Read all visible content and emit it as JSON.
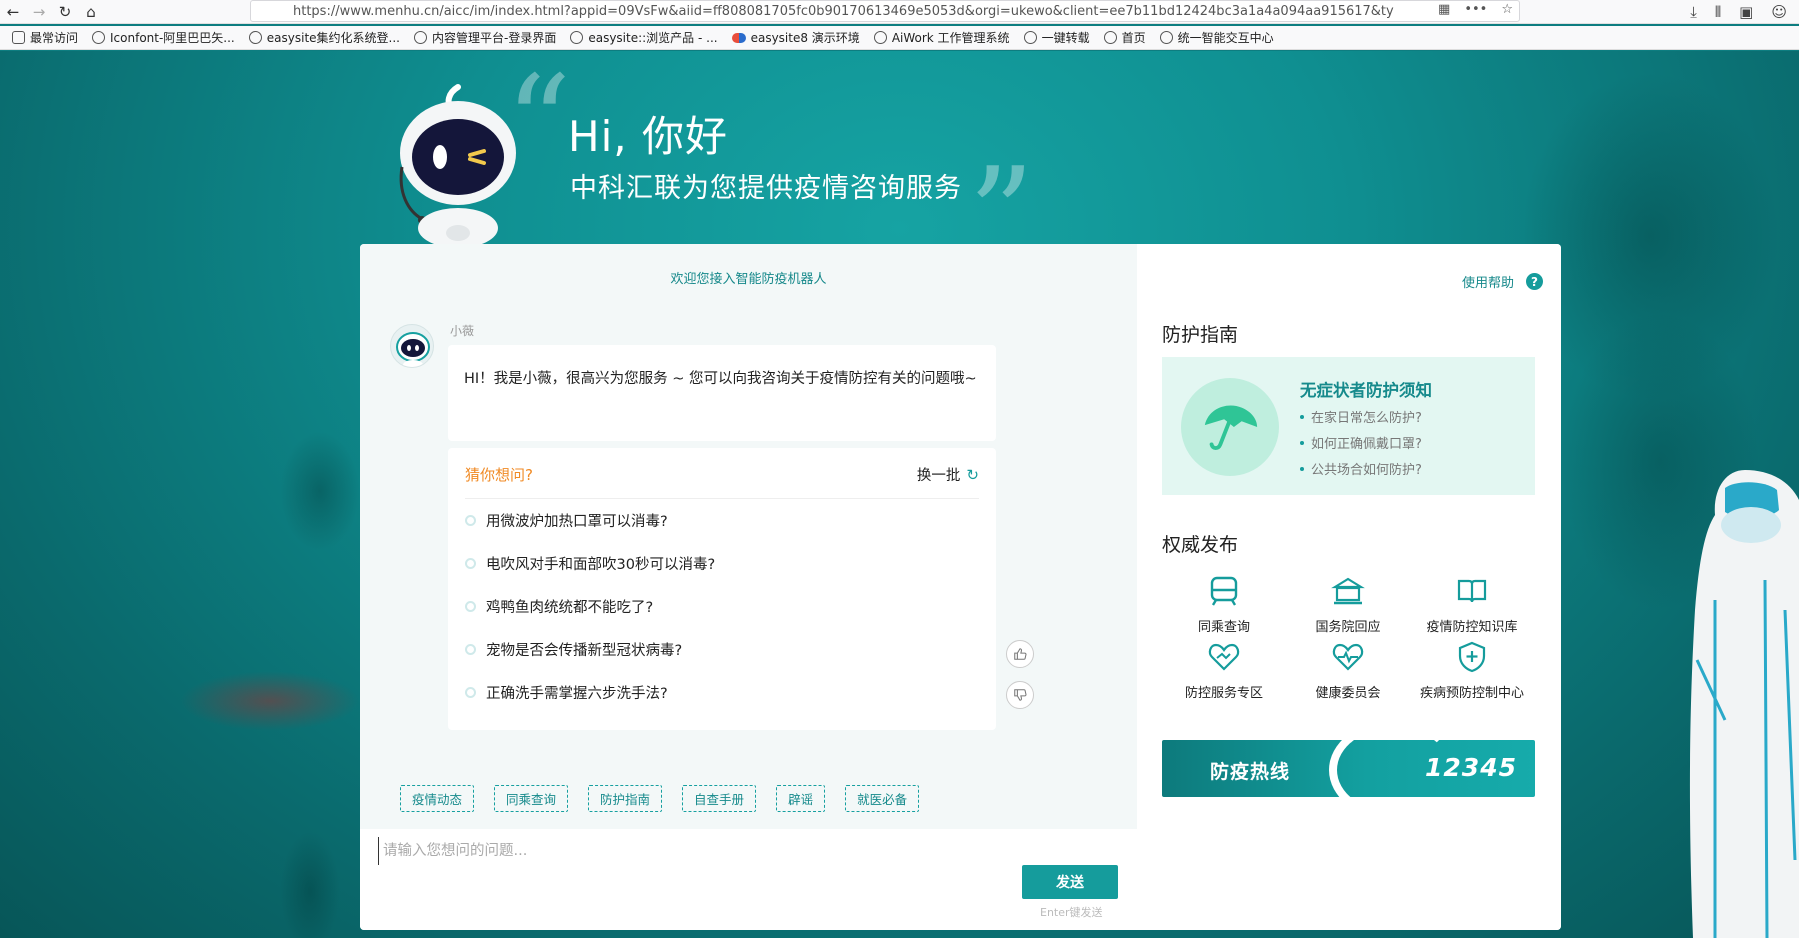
{
  "browser": {
    "url": "https://www.menhu.cn/aicc/im/index.html?appid=09VsFw&aiid=ff808081705fc0b90170613469e5053d&orgi=ukewo&client=ee7b11bd12424bc3a1a4a094aa915617&ty",
    "bookmarks": [
      "最常访问",
      "Iconfont-阿里巴巴矢...",
      "easysite集约化系统登...",
      "内容管理平台-登录界面",
      "easysite::浏览产品 - ...",
      "easysite8 演示环境",
      "AiWork 工作管理系统",
      "一键转载",
      "首页",
      "统一智能交互中心"
    ]
  },
  "hero": {
    "title": "Hi, 你好",
    "subtitle": "中科汇联为您提供疫情咨询服务"
  },
  "chat": {
    "welcome": "欢迎您接入智能防疫机器人",
    "bot_name": "小薇",
    "bot_message": "HI！我是小薇，很高兴为您服务 ~ 您可以向我咨询关于疫情防控有关的问题哦~",
    "guess_title": "猜你想问?",
    "refresh_label": "换一批",
    "questions": [
      "用微波炉加热口罩可以消毒?",
      "电吹风对手和面部吹30秒可以消毒?",
      "鸡鸭鱼肉统统都不能吃了?",
      "宠物是否会传播新型冠状病毒?",
      "正确洗手需掌握六步洗手法?"
    ],
    "tags": [
      "疫情动态",
      "同乘查询",
      "防护指南",
      "自查手册",
      "辟谣",
      "就医必备"
    ],
    "input_placeholder": "请输入您想问的问题...",
    "send_label": "发送",
    "send_hint": "Enter键发送"
  },
  "sidebar": {
    "help_label": "使用帮助",
    "help_icon": "?",
    "guide_heading": "防护指南",
    "guide_title": "无症状者防护须知",
    "guide_items": [
      "在家日常怎么防护?",
      "如何正确佩戴口罩?",
      "公共场合如何防护?"
    ],
    "authority_heading": "权威发布",
    "authority_items": [
      "同乘查询",
      "国务院回应",
      "疫情防控知识库",
      "防控服务专区",
      "健康委员会",
      "疾病预防控制中心"
    ],
    "hotline_label": "防疫热线",
    "hotline_number": "12345"
  },
  "colors": {
    "brand": "#159c9c",
    "accent_orange": "#f08a24",
    "guide_bg": "#e3f7f2"
  }
}
